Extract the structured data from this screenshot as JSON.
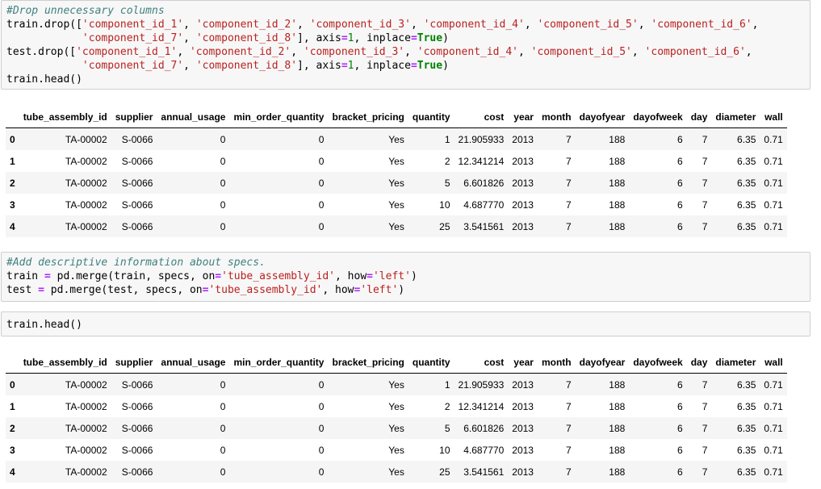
{
  "cells": [
    {
      "lines": [
        [
          {
            "t": "#Drop unnecessary columns",
            "c": "c-comment"
          }
        ],
        [
          {
            "t": "train.drop(["
          },
          {
            "t": "'component_id_1'",
            "c": "c-str"
          },
          {
            "t": ", "
          },
          {
            "t": "'component_id_2'",
            "c": "c-str"
          },
          {
            "t": ", "
          },
          {
            "t": "'component_id_3'",
            "c": "c-str"
          },
          {
            "t": ", "
          },
          {
            "t": "'component_id_4'",
            "c": "c-str"
          },
          {
            "t": ", "
          },
          {
            "t": "'component_id_5'",
            "c": "c-str"
          },
          {
            "t": ", "
          },
          {
            "t": "'component_id_6'",
            "c": "c-str"
          },
          {
            "t": ","
          }
        ],
        [
          {
            "t": "            "
          },
          {
            "t": "'component_id_7'",
            "c": "c-str"
          },
          {
            "t": ", "
          },
          {
            "t": "'component_id_8'",
            "c": "c-str"
          },
          {
            "t": "], axis"
          },
          {
            "t": "=",
            "c": "c-op"
          },
          {
            "t": "1",
            "c": "c-num"
          },
          {
            "t": ", inplace"
          },
          {
            "t": "=",
            "c": "c-op"
          },
          {
            "t": "True",
            "c": "c-kw"
          },
          {
            "t": ")"
          }
        ],
        [
          {
            "t": "test.drop(["
          },
          {
            "t": "'component_id_1'",
            "c": "c-str"
          },
          {
            "t": ", "
          },
          {
            "t": "'component_id_2'",
            "c": "c-str"
          },
          {
            "t": ", "
          },
          {
            "t": "'component_id_3'",
            "c": "c-str"
          },
          {
            "t": ", "
          },
          {
            "t": "'component_id_4'",
            "c": "c-str"
          },
          {
            "t": ", "
          },
          {
            "t": "'component_id_5'",
            "c": "c-str"
          },
          {
            "t": ", "
          },
          {
            "t": "'component_id_6'",
            "c": "c-str"
          },
          {
            "t": ","
          }
        ],
        [
          {
            "t": "            "
          },
          {
            "t": "'component_id_7'",
            "c": "c-str"
          },
          {
            "t": ", "
          },
          {
            "t": "'component_id_8'",
            "c": "c-str"
          },
          {
            "t": "], axis"
          },
          {
            "t": "=",
            "c": "c-op"
          },
          {
            "t": "1",
            "c": "c-num"
          },
          {
            "t": ", inplace"
          },
          {
            "t": "=",
            "c": "c-op"
          },
          {
            "t": "True",
            "c": "c-kw"
          },
          {
            "t": ")"
          }
        ],
        [
          {
            "t": "train.head()"
          }
        ]
      ]
    },
    {
      "lines": [
        [
          {
            "t": "#Add descriptive information about specs.",
            "c": "c-comment"
          }
        ],
        [
          {
            "t": "train "
          },
          {
            "t": "=",
            "c": "c-op"
          },
          {
            "t": " pd.merge(train, specs, on"
          },
          {
            "t": "=",
            "c": "c-op"
          },
          {
            "t": "'tube_assembly_id'",
            "c": "c-str"
          },
          {
            "t": ", how"
          },
          {
            "t": "=",
            "c": "c-op"
          },
          {
            "t": "'left'",
            "c": "c-str"
          },
          {
            "t": ")"
          }
        ],
        [
          {
            "t": "test "
          },
          {
            "t": "=",
            "c": "c-op"
          },
          {
            "t": " pd.merge(test, specs, on"
          },
          {
            "t": "=",
            "c": "c-op"
          },
          {
            "t": "'tube_assembly_id'",
            "c": "c-str"
          },
          {
            "t": ", how"
          },
          {
            "t": "=",
            "c": "c-op"
          },
          {
            "t": "'left'",
            "c": "c-str"
          },
          {
            "t": ")"
          }
        ]
      ]
    },
    {
      "lines": [
        [
          {
            "t": "train.head()"
          }
        ]
      ]
    }
  ],
  "table": {
    "columns": [
      "",
      "tube_assembly_id",
      "supplier",
      "annual_usage",
      "min_order_quantity",
      "bracket_pricing",
      "quantity",
      "cost",
      "year",
      "month",
      "dayofyear",
      "dayofweek",
      "day",
      "diameter",
      "wall"
    ],
    "rows": [
      [
        "0",
        "TA-00002",
        "S-0066",
        "0",
        "0",
        "Yes",
        "1",
        "21.905933",
        "2013",
        "7",
        "188",
        "6",
        "7",
        "6.35",
        "0.71"
      ],
      [
        "1",
        "TA-00002",
        "S-0066",
        "0",
        "0",
        "Yes",
        "2",
        "12.341214",
        "2013",
        "7",
        "188",
        "6",
        "7",
        "6.35",
        "0.71"
      ],
      [
        "2",
        "TA-00002",
        "S-0066",
        "0",
        "0",
        "Yes",
        "5",
        "6.601826",
        "2013",
        "7",
        "188",
        "6",
        "7",
        "6.35",
        "0.71"
      ],
      [
        "3",
        "TA-00002",
        "S-0066",
        "0",
        "0",
        "Yes",
        "10",
        "4.687770",
        "2013",
        "7",
        "188",
        "6",
        "7",
        "6.35",
        "0.71"
      ],
      [
        "4",
        "TA-00002",
        "S-0066",
        "0",
        "0",
        "Yes",
        "25",
        "3.541561",
        "2013",
        "7",
        "188",
        "6",
        "7",
        "6.35",
        "0.71"
      ]
    ]
  }
}
